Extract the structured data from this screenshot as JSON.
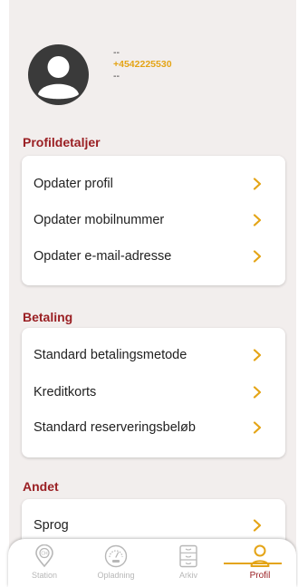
{
  "profile": {
    "name": "--",
    "phone": "+4542225530",
    "email": "--"
  },
  "sections": {
    "profile_details": {
      "title": "Profildetaljer",
      "items": [
        "Opdater profil",
        "Opdater mobilnummer",
        "Opdater e-mail-adresse"
      ]
    },
    "payment": {
      "title": "Betaling",
      "items": [
        "Standard betalingsmetode",
        "Kreditkorts",
        "Standard reserveringsbeløb"
      ]
    },
    "other": {
      "title": "Andet",
      "items": [
        "Sprog"
      ]
    }
  },
  "tabbar": {
    "tabs": [
      {
        "label": "Station",
        "icon": "station-pin-icon",
        "active": false
      },
      {
        "label": "Opladning",
        "icon": "charging-gauge-icon",
        "active": false
      },
      {
        "label": "Arkiv",
        "icon": "archive-cabinet-icon",
        "active": false
      },
      {
        "label": "Profil",
        "icon": "person-icon",
        "active": true
      }
    ]
  },
  "colors": {
    "accent": "#e4a416",
    "section_title": "#9a1f23",
    "background": "#f2eeed",
    "inactive_tab": "#b7b7b7"
  }
}
